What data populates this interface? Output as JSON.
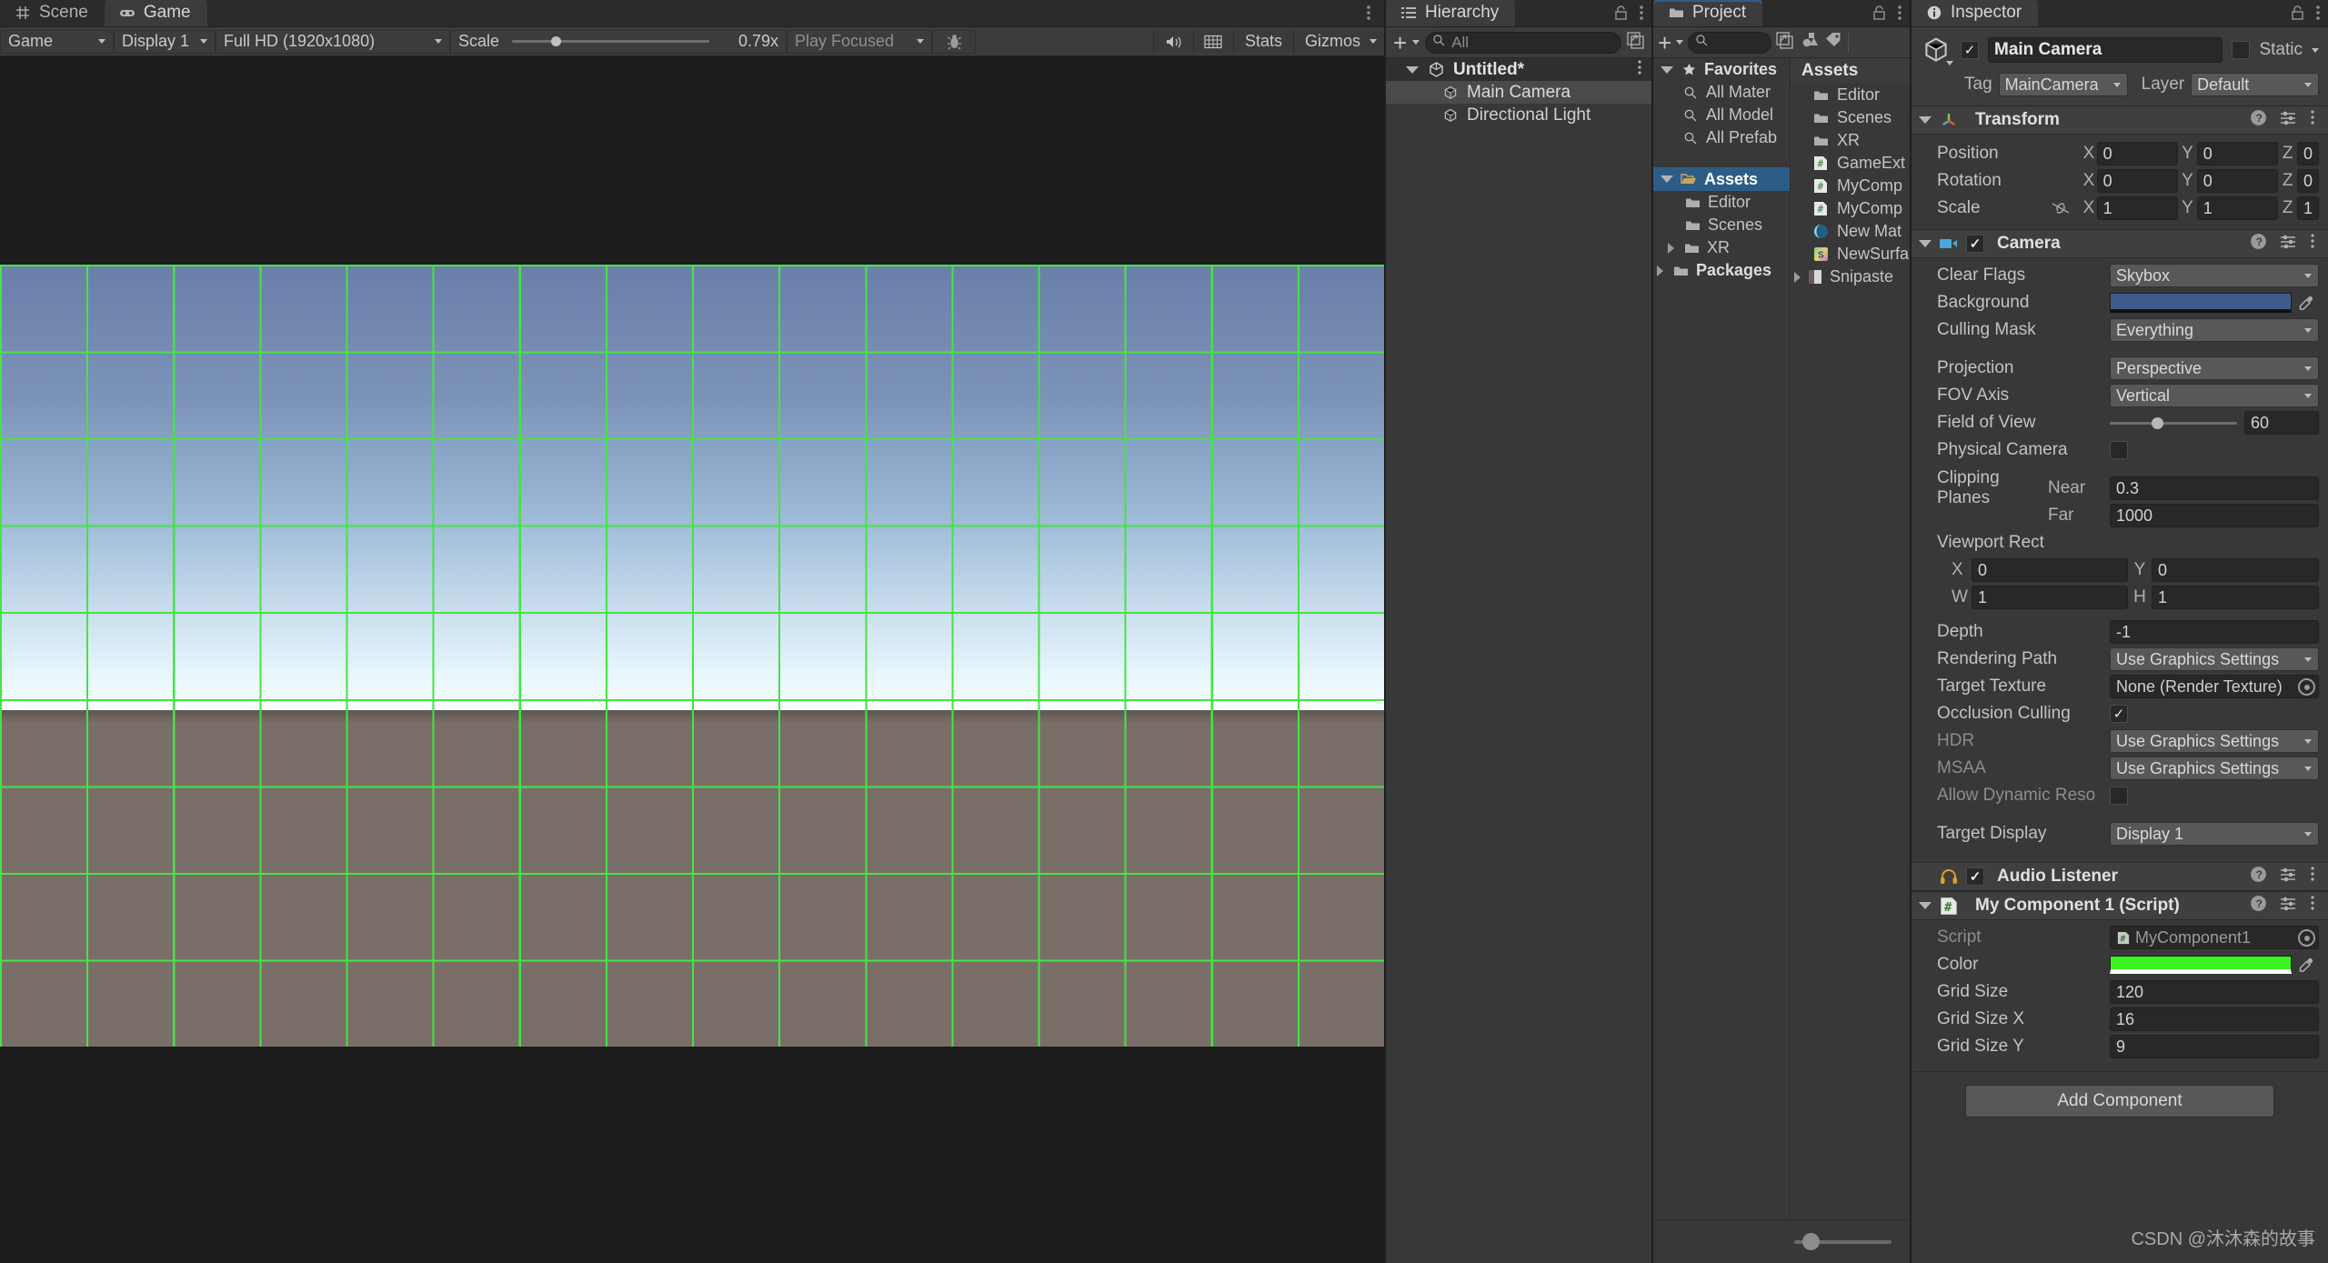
{
  "app": "Unity Editor",
  "game_panel": {
    "tabs": [
      {
        "label": "Scene",
        "icon": "grid-icon",
        "active": false
      },
      {
        "label": "Game",
        "icon": "gamepad-icon",
        "active": true
      }
    ],
    "toolbar": {
      "view_mode": "Game",
      "display": "Display 1",
      "aspect": "Full HD (1920x1080)",
      "scale_label": "Scale",
      "scale_value": "0.79x",
      "scale_percent": 20,
      "play_mode": "Play Focused",
      "mute_icon": "speaker-icon",
      "stats_label": "Stats",
      "gizmos_label": "Gizmos",
      "bug_icon": "bug-icon",
      "aspect_grid_icon": "aspect-grid-icon",
      "add_icon": "plus-icon"
    },
    "render": {
      "sky_top": "#6a7fa8",
      "sky_bottom": "#e8f6fd",
      "ground": "#7a6f68",
      "grid_color": "#44e444",
      "cols": 16,
      "rows": 9
    }
  },
  "hierarchy": {
    "title": "Hierarchy",
    "search_placeholder": "All",
    "search_value": "",
    "scene": {
      "label": "Untitled*",
      "icon": "unity-scene-icon"
    },
    "items": [
      {
        "label": "Main Camera",
        "icon": "gameobject-icon",
        "selected": true
      },
      {
        "label": "Directional Light",
        "icon": "gameobject-icon",
        "selected": false
      }
    ]
  },
  "project": {
    "title": "Project",
    "search_placeholder": "",
    "search_value": "",
    "tree": [
      {
        "label": "Favorites",
        "icon": "star-icon",
        "depth": 0,
        "expanded": true,
        "selected": false
      },
      {
        "label": "All Mater",
        "icon": "search-icon",
        "depth": 1,
        "selected": false
      },
      {
        "label": "All Model",
        "icon": "search-icon",
        "depth": 1,
        "selected": false
      },
      {
        "label": "All Prefab",
        "icon": "search-icon",
        "depth": 1,
        "selected": false
      },
      {
        "label": "Assets",
        "icon": "folder-open-icon",
        "depth": 0,
        "expanded": true,
        "selected": true
      },
      {
        "label": "Editor",
        "icon": "folder-icon",
        "depth": 1,
        "selected": false
      },
      {
        "label": "Scenes",
        "icon": "folder-icon",
        "depth": 1,
        "selected": false
      },
      {
        "label": "XR",
        "icon": "folder-icon",
        "depth": 1,
        "expandable": true,
        "selected": false
      },
      {
        "label": "Packages",
        "icon": "folder-icon",
        "depth": 0,
        "expandable": true,
        "selected": false
      }
    ],
    "content_header": "Assets",
    "content": [
      {
        "label": "Editor",
        "icon": "folder-icon"
      },
      {
        "label": "Scenes",
        "icon": "folder-icon"
      },
      {
        "label": "XR",
        "icon": "folder-icon"
      },
      {
        "label": "GameExt",
        "icon": "csharp-script-icon"
      },
      {
        "label": "MyComp",
        "icon": "csharp-script-icon"
      },
      {
        "label": "MyComp",
        "icon": "csharp-script-icon"
      },
      {
        "label": "New Mat",
        "icon": "material-icon"
      },
      {
        "label": "NewSurfa",
        "icon": "shader-icon"
      },
      {
        "label": "Snipaste",
        "icon": "image-icon",
        "expandable": true
      }
    ],
    "zoom_slider_percent": 8
  },
  "inspector": {
    "title": "Inspector",
    "object": {
      "name": "Main Camera",
      "enabled": true,
      "static_label": "Static",
      "static_checked": false,
      "tag_label": "Tag",
      "tag_value": "MainCamera",
      "layer_label": "Layer",
      "layer_value": "Default"
    },
    "components": [
      {
        "name": "Transform",
        "icon": "transform-axis-icon",
        "expanded": true,
        "has_enable_toggle": false,
        "vectors": [
          {
            "label": "Position",
            "x": "0",
            "y": "0",
            "z": "0"
          },
          {
            "label": "Rotation",
            "x": "0",
            "y": "0",
            "z": "0"
          },
          {
            "label": "Scale",
            "x": "1",
            "y": "1",
            "z": "1",
            "link_icon": "link-off-icon"
          }
        ]
      },
      {
        "name": "Camera",
        "icon": "camera-icon",
        "expanded": true,
        "has_enable_toggle": true,
        "enabled": true,
        "fields": [
          {
            "label": "Clear Flags",
            "type": "dropdown",
            "value": "Skybox"
          },
          {
            "label": "Background",
            "type": "color",
            "value": "#3d5c8c"
          },
          {
            "label": "Culling Mask",
            "type": "dropdown",
            "value": "Everything"
          },
          {
            "label": "",
            "type": "spacer"
          },
          {
            "label": "Projection",
            "type": "dropdown",
            "value": "Perspective"
          },
          {
            "label": "FOV Axis",
            "type": "dropdown",
            "value": "Vertical"
          },
          {
            "label": "Field of View",
            "type": "slider",
            "value": "60",
            "percent": 33
          },
          {
            "label": "Physical Camera",
            "type": "checkbox",
            "checked": false
          },
          {
            "label": "",
            "type": "spacer"
          },
          {
            "label": "Clipping Planes",
            "type": "pair",
            "sub1": "Near",
            "val1": "0.3",
            "sub2": "Far",
            "val2": "1000"
          },
          {
            "label": "Viewport Rect",
            "type": "rect",
            "x_label": "X",
            "x": "0",
            "y_label": "Y",
            "y": "0",
            "w_label": "W",
            "w": "1",
            "h_label": "H",
            "h": "1"
          },
          {
            "label": "Depth",
            "type": "text",
            "value": "-1"
          },
          {
            "label": "Rendering Path",
            "type": "dropdown",
            "value": "Use Graphics Settings"
          },
          {
            "label": "Target Texture",
            "type": "object",
            "value": "None (Render Texture)"
          },
          {
            "label": "Occlusion Culling",
            "type": "checkbox",
            "checked": true
          },
          {
            "label": "HDR",
            "type": "dropdown",
            "value": "Use Graphics Settings"
          },
          {
            "label": "MSAA",
            "type": "dropdown",
            "value": "Use Graphics Settings"
          },
          {
            "label": "Allow Dynamic Reso",
            "type": "checkbox",
            "checked": false
          },
          {
            "label": "",
            "type": "spacer"
          },
          {
            "label": "Target Display",
            "type": "dropdown",
            "value": "Display 1"
          }
        ]
      },
      {
        "name": "Audio Listener",
        "icon": "headphones-icon",
        "expanded": false,
        "has_enable_toggle": true,
        "enabled": true,
        "fields": []
      },
      {
        "name": "My Component 1 (Script)",
        "icon": "csharp-script-icon",
        "expanded": true,
        "has_enable_toggle": false,
        "fields": [
          {
            "label": "Script",
            "type": "object",
            "value": "MyComponent1",
            "dim": true
          },
          {
            "label": "Color",
            "type": "color",
            "value": "#3bf521"
          },
          {
            "label": "Grid Size",
            "type": "text",
            "value": "120"
          },
          {
            "label": "Grid Size X",
            "type": "text",
            "value": "16"
          },
          {
            "label": "Grid Size Y",
            "type": "text",
            "value": "9"
          }
        ]
      }
    ],
    "add_component_label": "Add Component"
  },
  "watermark": "CSDN @沐沐森的故事"
}
